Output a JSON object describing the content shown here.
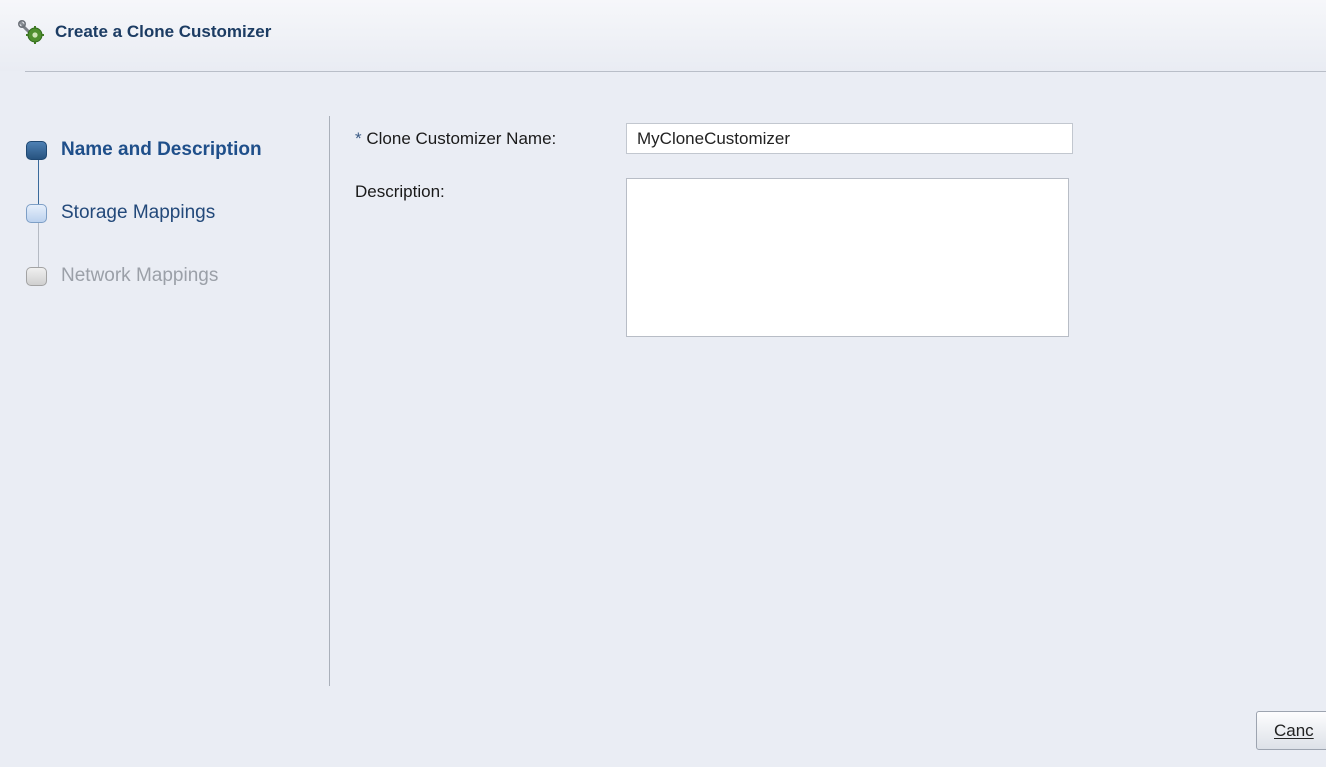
{
  "window": {
    "title": "Create a Clone Customizer",
    "icon": "clone-customizer-icon"
  },
  "train": {
    "steps": [
      {
        "label": "Name and Description",
        "state": "current"
      },
      {
        "label": "Storage Mappings",
        "state": "enabled"
      },
      {
        "label": "Network Mappings",
        "state": "disabled"
      }
    ]
  },
  "form": {
    "name_required_marker": "*",
    "name_label": "Clone Customizer Name:",
    "name_value": "MyCloneCustomizer",
    "description_label": "Description:",
    "description_value": ""
  },
  "footer": {
    "cancel_label": "Canc"
  },
  "colors": {
    "title_text": "#1c3c63",
    "current_step": "#1f4f8a",
    "disabled_step": "#9ba0a8",
    "background": "#eaedf4"
  }
}
